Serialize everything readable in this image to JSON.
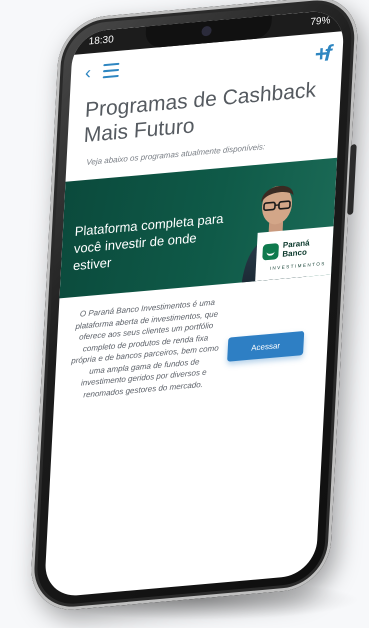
{
  "status_bar": {
    "time": "18:30",
    "battery": "79%"
  },
  "nav": {
    "back_glyph": "‹",
    "logo_text": "+f"
  },
  "header": {
    "title": "Programas de Cashback Mais Futuro",
    "subtitle": "Veja abaixo os programas atualmente disponíveis:"
  },
  "banner": {
    "headline": "Plataforma completa para você investir de onde estiver",
    "bank_name": "Paraná Banco",
    "bank_tagline": "INVESTIMENTOS"
  },
  "program": {
    "description": "O Paraná Banco Investimentos é uma plataforma aberta de investimentos, que oferece aos seus clientes um portfólio completo de produtos de renda fixa própria e de bancos parceiros, bem como uma ampla gama de fundos de investimento geridos por diversos e renomados gestores do mercado.",
    "cta_label": "Acessar"
  },
  "colors": {
    "accent": "#2e7fc4",
    "banner_green": "#0f5a48"
  }
}
